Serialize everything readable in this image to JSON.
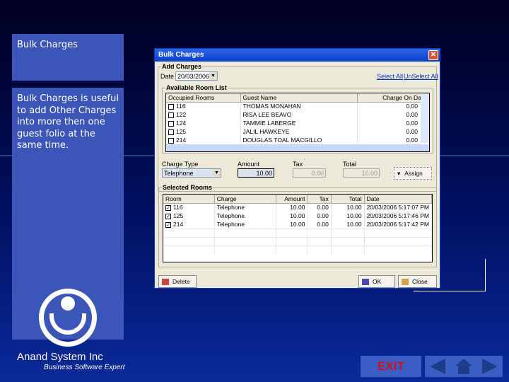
{
  "slide": {
    "title": "Bulk Charges",
    "description": "Bulk Charges is useful to add Other Charges into more then one guest folio at the same time.",
    "company": "Anand System Inc",
    "tagline": "Business Software Expert",
    "exit_label": "EXIT"
  },
  "window": {
    "title": "Bulk Charges",
    "close": "✕",
    "add_charges": {
      "legend": "Add Charges",
      "date_label": "Date",
      "date_value": "20/03/2006",
      "select_all": "Select All",
      "unselect_all": "UnSelect All"
    },
    "room_list": {
      "legend": "Available Room List",
      "columns": [
        "Occupied Rooms",
        "Guest Name",
        "Charge On Date"
      ],
      "rows": [
        {
          "room": "116",
          "guest": "THOMAS MONAHAN",
          "charge": "0.00"
        },
        {
          "room": "122",
          "guest": "RISA LEE BEAVO",
          "charge": "0.00"
        },
        {
          "room": "124",
          "guest": "TAMMIE LABERGE",
          "charge": "0.00"
        },
        {
          "room": "125",
          "guest": "JALIL HAWKEYE",
          "charge": "0.00"
        },
        {
          "room": "214",
          "guest": "DOUGLAS TOAL MACGILLO",
          "charge": "0.00"
        }
      ]
    },
    "charge_type": {
      "label": "Charge Type",
      "value": "Telephone"
    },
    "amount": {
      "label": "Amount",
      "value": "10.00"
    },
    "tax": {
      "label": "Tax",
      "value": "0.00"
    },
    "total": {
      "label": "Total",
      "value": "10.00"
    },
    "assign_label": "Assign",
    "selected": {
      "legend": "Selected Rooms",
      "columns": [
        "Room",
        "Charge",
        "Amount",
        "Tax",
        "Total",
        "Date"
      ],
      "rows": [
        {
          "room": "116",
          "charge": "Telephone",
          "amount": "10.00",
          "tax": "0.00",
          "total": "10.00",
          "date": "20/03/2006 5:17:07 PM"
        },
        {
          "room": "125",
          "charge": "Telephone",
          "amount": "10.00",
          "tax": "0.00",
          "total": "10.00",
          "date": "20/03/2006 5:17:46 PM"
        },
        {
          "room": "214",
          "charge": "Telephone",
          "amount": "10.00",
          "tax": "0.00",
          "total": "10.00",
          "date": "20/03/2006 5:17:42 PM"
        }
      ]
    },
    "delete_label": "Delete",
    "ok_label": "OK",
    "close_label": "Close"
  }
}
